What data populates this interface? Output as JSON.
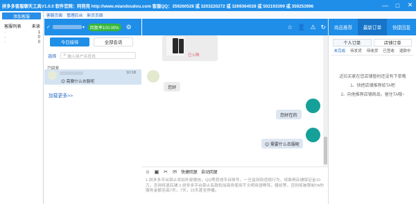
{
  "window": {
    "title": "拼多多客服聊天工具V1.0.0  软件官网：阿兜兜 http://www.miandoudou.com  客服QQ：359260528 或 3203220272 或 3269364028 或 502193399 或 359253996",
    "min": "—",
    "max": "□",
    "close": "✕"
  },
  "sidebar": {
    "add_btn": "添加客服",
    "col_list": "客服列表",
    "col_unread": "未读",
    "rows": [
      {
        "name": "·",
        "unread": "1"
      },
      {
        "name": "·",
        "unread": "0"
      },
      {
        "name": "·",
        "unread": "0"
      }
    ]
  },
  "toplinks": [
    "客服页面",
    "管理后台",
    "新页页面"
  ],
  "session_header": {
    "check": "✓",
    "caret": "▾",
    "rate": "回复率100.00%"
  },
  "session_tabs": {
    "today": "今日接待",
    "all": "全部会话"
  },
  "search": {
    "select": "选择",
    "placeholder": "输入用户名查找"
  },
  "session_list": {
    "group": "已回复",
    "items": [
      {
        "time": "10:18",
        "msg": "😊 需要什么衣服呢"
      }
    ],
    "load_more": "加载更多>>"
  },
  "chat": {
    "product_tag": "已入购",
    "m1": "您好",
    "m2": "您好在的",
    "m3": "😊 需要什么衣服呢"
  },
  "toolbar": {
    "quick_reply": "快捷回复",
    "auto_reply": "自动回复"
  },
  "input": {
    "placeholder": "1.拼多多平台禁止添加外部微信，QQ等其他平台账号，一旦监测到违规行为，将面再店铺保证金10万，否则将退店铺  2.拼多多平台禁止有款和加商务使用不文明用语辱骂，骚扰等，否则将被限制TA的服务金额至高7天，7天，15天甚至停播。"
  },
  "right": {
    "tabs": [
      "商品推荐",
      "最新订单",
      "快捷回复"
    ],
    "active_tab": 1,
    "subtabs": [
      "个人订单",
      "店铺订单"
    ],
    "status_tabs": [
      "未完成",
      "待发货",
      "待收货",
      "已签收",
      "退款中"
    ],
    "message": [
      "近拉买家在您店铺暂时还没有下单哦",
      "1、快把店铺推荐给TA吧",
      "2、向他推荐店铺商品，留住TA哦~"
    ]
  },
  "colors": {
    "accent": "#1f8ee8",
    "link": "#2469c4",
    "teal_avatar": "#16a09a",
    "badge": "#35b63a"
  }
}
